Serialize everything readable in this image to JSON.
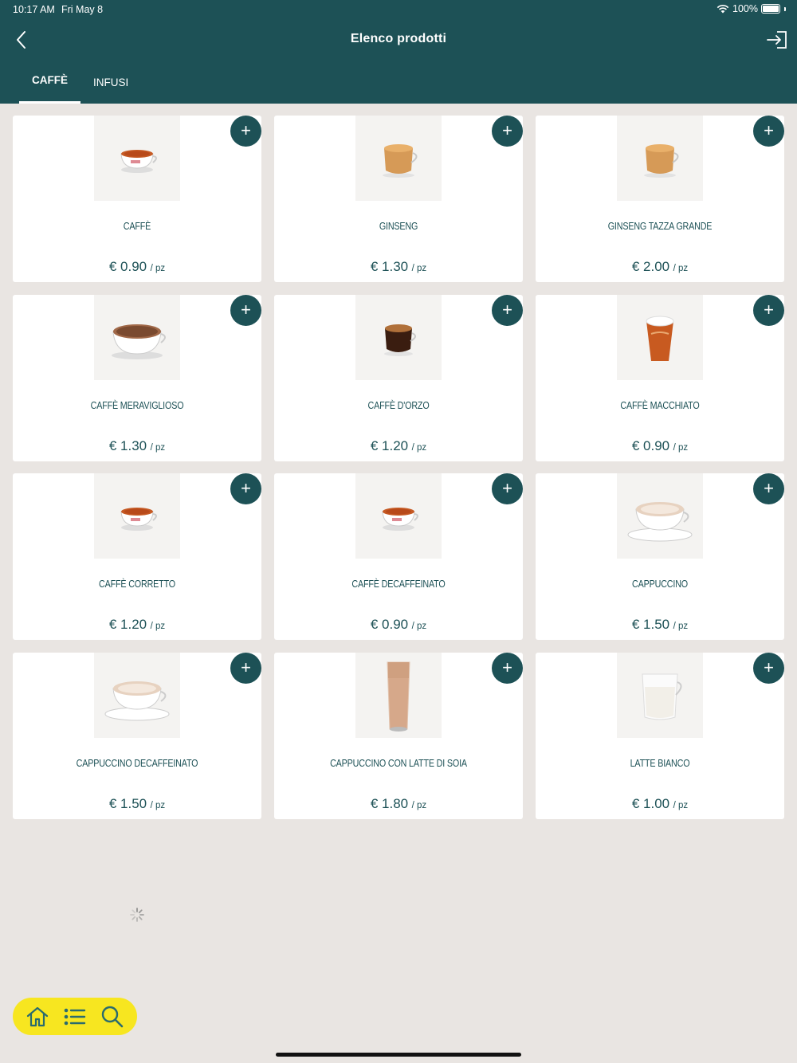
{
  "status_bar": {
    "time": "10:17 AM",
    "date": "Fri May 8",
    "battery": "100%"
  },
  "header": {
    "title": "Elenco prodotti"
  },
  "tabs": [
    {
      "label": "CAFFÈ",
      "active": true
    },
    {
      "label": "INFUSI",
      "active": false
    }
  ],
  "products": [
    {
      "name": "CAFFÈ",
      "price": "€ 0.90",
      "unit": "/ pz",
      "image": "espresso-cup"
    },
    {
      "name": "GINSENG",
      "price": "€ 1.30",
      "unit": "/ pz",
      "image": "glass-cup"
    },
    {
      "name": "GINSENG TAZZA GRANDE",
      "price": "€ 2.00",
      "unit": "/ pz",
      "image": "glass-cup-large"
    },
    {
      "name": "CAFFÈ MERAVIGLIOSO",
      "price": "€ 1.30",
      "unit": "/ pz",
      "image": "cocoa-cup"
    },
    {
      "name": "CAFFÈ D'ORZO",
      "price": "€ 1.20",
      "unit": "/ pz",
      "image": "dark-glass-cup"
    },
    {
      "name": "CAFFÈ MACCHIATO",
      "price": "€ 0.90",
      "unit": "/ pz",
      "image": "macchiato-glass"
    },
    {
      "name": "CAFFÈ CORRETTO",
      "price": "€ 1.20",
      "unit": "/ pz",
      "image": "espresso-cup"
    },
    {
      "name": "CAFFÈ DECAFFEINATO",
      "price": "€ 0.90",
      "unit": "/ pz",
      "image": "espresso-cup"
    },
    {
      "name": "CAPPUCCINO",
      "price": "€ 1.50",
      "unit": "/ pz",
      "image": "cappuccino-cup"
    },
    {
      "name": "CAPPUCCINO DECAFFEINATO",
      "price": "€ 1.50",
      "unit": "/ pz",
      "image": "cappuccino-cup"
    },
    {
      "name": "CAPPUCCINO CON LATTE DI SOIA",
      "price": "€ 1.80",
      "unit": "/ pz",
      "image": "tall-glass"
    },
    {
      "name": "LATTE BIANCO",
      "price": "€ 1.00",
      "unit": "/ pz",
      "image": "milk-glass"
    }
  ],
  "add_label": "+",
  "colors": {
    "primary": "#1d5156",
    "background": "#e9e5e2",
    "accent": "#f7e620"
  },
  "bottom_nav": [
    "home-icon",
    "list-icon",
    "search-icon"
  ]
}
